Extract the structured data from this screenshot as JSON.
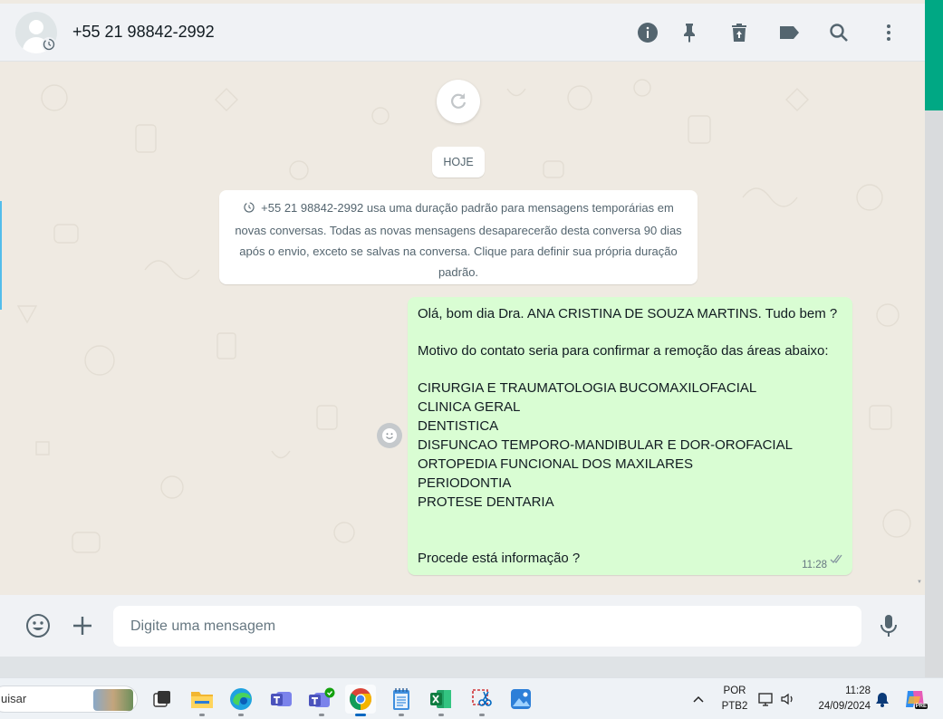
{
  "header": {
    "contact_name": "+55 21 98842-2992",
    "icons": [
      "info-icon",
      "pin-icon",
      "delete-icon",
      "label-icon",
      "search-icon",
      "more-vertical-icon"
    ]
  },
  "chat": {
    "date_label": "HOJE",
    "system_message": "+55 21 98842-2992 usa uma duração padrão para mensagens temporárias em novas conversas. Todas as novas mensagens desaparecerão desta conversa 90 dias após o envio, exceto se salvas na conversa. Clique para definir sua própria duração padrão.",
    "system_lines": [
      "+55 21 98842-2992 usa uma duração padrão para mensagens temporárias em",
      "novas conversas. Todas as novas mensagens desaparecerão desta conversa 90 dias",
      "após o envio, exceto se salvas na conversa. Clique para definir sua própria duração",
      "padrão."
    ],
    "message": {
      "lines": [
        "Olá, bom dia Dra. ANA CRISTINA DE SOUZA MARTINS. Tudo bem ?",
        "Motivo do contato seria para confirmar a remoção das áreas abaixo:",
        "CIRURGIA E TRAUMATOLOGIA BUCOMAXILOFACIAL",
        "CLINICA GERAL",
        "DENTISTICA",
        "DISFUNCAO TEMPORO-MANDIBULAR E DOR-OROFACIAL",
        "ORTOPEDIA FUNCIONAL DOS MAXILARES",
        "PERIODONTIA",
        "PROTESE DENTARIA",
        "Procede está informação ?"
      ],
      "time": "11:28",
      "status": "read"
    }
  },
  "composer": {
    "placeholder": "Digite uma mensagem"
  },
  "taskbar": {
    "search_text": "uisar",
    "lang_top": "POR",
    "lang_bottom": "PTB2",
    "clock_time": "11:28",
    "clock_date": "24/09/2024",
    "copilot_badge": "PRE"
  },
  "colors": {
    "accent": "#00a884",
    "outgoing_bubble": "#d9fdd3",
    "chat_bg": "#efeae2",
    "read_tick": "#667781"
  }
}
